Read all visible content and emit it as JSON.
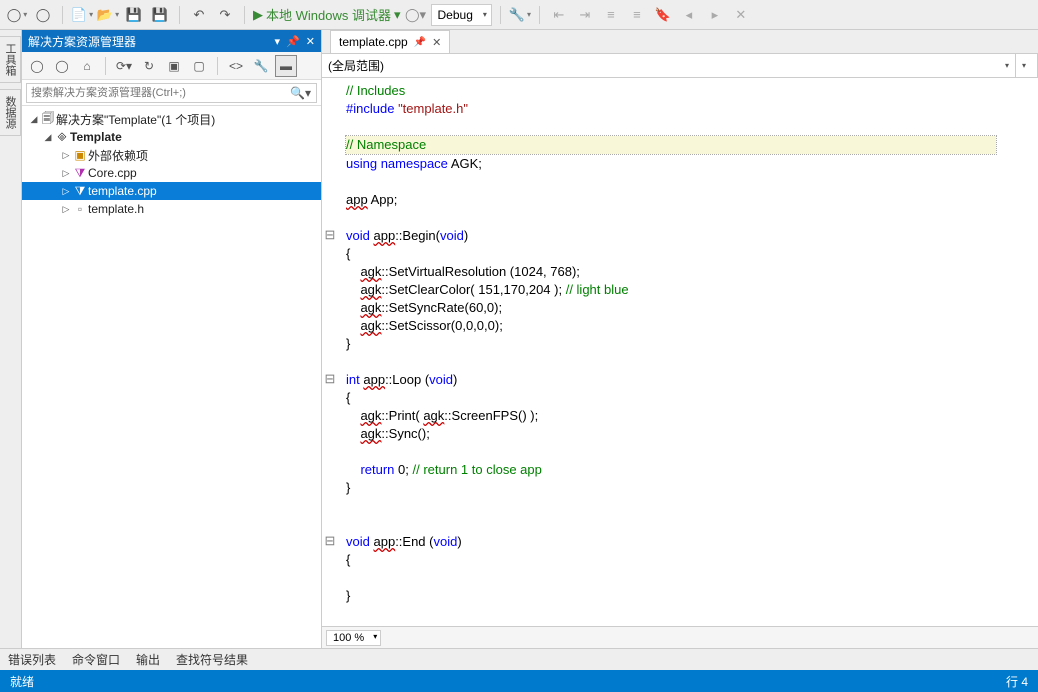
{
  "toolbar": {
    "run_label": "本地 Windows 调试器",
    "config": "Debug"
  },
  "left_tabs": [
    "工具箱",
    "数据源"
  ],
  "panel": {
    "title": "解决方案资源管理器",
    "search_placeholder": "搜索解决方案资源管理器(Ctrl+;)",
    "tree": {
      "solution": "解决方案\"Template\"(1 个项目)",
      "project": "Template",
      "items": [
        "外部依赖项",
        "Core.cpp",
        "template.cpp",
        "template.h"
      ],
      "selected_index": 2
    }
  },
  "editor": {
    "tab_label": "template.cpp",
    "scope_global": "(全局范围)",
    "zoom": "100 %",
    "code_lines": [
      {
        "text": "// Includes",
        "kind": "comment"
      },
      {
        "text": "#include \"template.h\"",
        "kind": "include"
      },
      {
        "text": "",
        "kind": ""
      },
      {
        "text": "// Namespace",
        "kind": "comment",
        "hl": true
      },
      {
        "text": "using namespace AGK;",
        "kind": "using"
      },
      {
        "text": "",
        "kind": ""
      },
      {
        "text": "app App;",
        "kind": "decl"
      },
      {
        "text": "",
        "kind": ""
      },
      {
        "text": "void app::Begin(void)",
        "kind": "sig",
        "outline": "⊟"
      },
      {
        "text": "{",
        "kind": ""
      },
      {
        "text": "    agk::SetVirtualResolution (1024, 768);",
        "kind": "call"
      },
      {
        "text": "    agk::SetClearColor( 151,170,204 ); // light blue",
        "kind": "call_comment"
      },
      {
        "text": "    agk::SetSyncRate(60,0);",
        "kind": "call"
      },
      {
        "text": "    agk::SetScissor(0,0,0,0);",
        "kind": "call"
      },
      {
        "text": "}",
        "kind": ""
      },
      {
        "text": "",
        "kind": ""
      },
      {
        "text": "int app::Loop (void)",
        "kind": "sig_int",
        "outline": "⊟"
      },
      {
        "text": "{",
        "kind": ""
      },
      {
        "text": "    agk::Print( agk::ScreenFPS() );",
        "kind": "call2"
      },
      {
        "text": "    agk::Sync();",
        "kind": "call"
      },
      {
        "text": "",
        "kind": ""
      },
      {
        "text": "    return 0; // return 1 to close app",
        "kind": "return_comment"
      },
      {
        "text": "}",
        "kind": ""
      },
      {
        "text": "",
        "kind": ""
      },
      {
        "text": "",
        "kind": ""
      },
      {
        "text": "void app::End (void)",
        "kind": "sig",
        "outline": "⊟"
      },
      {
        "text": "{",
        "kind": ""
      },
      {
        "text": "",
        "kind": ""
      },
      {
        "text": "}",
        "kind": ""
      }
    ]
  },
  "bottom_tabs": [
    "错误列表",
    "命令窗口",
    "输出",
    "查找符号结果"
  ],
  "status": {
    "left": "就绪",
    "right": "行 4"
  }
}
